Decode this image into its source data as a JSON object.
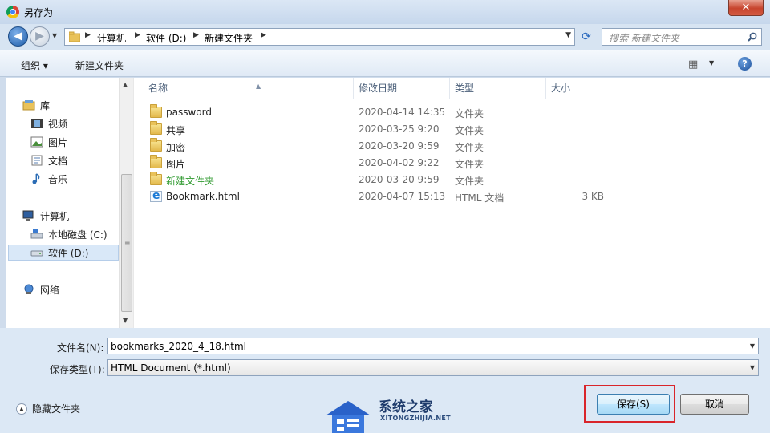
{
  "window": {
    "title": "另存为",
    "close_label": "✕"
  },
  "address": {
    "crumbs": [
      "计算机",
      "软件 (D:)",
      "新建文件夹"
    ],
    "search_placeholder": "搜索 新建文件夹"
  },
  "toolbar": {
    "organize_label": "组织 ▾",
    "new_folder_label": "新建文件夹",
    "help_label": "?"
  },
  "navigation": {
    "items": [
      {
        "label": "库",
        "icon": "library-icon"
      },
      {
        "label": "视频",
        "icon": "video-icon"
      },
      {
        "label": "图片",
        "icon": "picture-icon"
      },
      {
        "label": "文档",
        "icon": "document-icon"
      },
      {
        "label": "音乐",
        "icon": "music-icon"
      },
      {
        "label": "计算机",
        "icon": "computer-icon"
      },
      {
        "label": "本地磁盘 (C:)",
        "icon": "drive-icon"
      },
      {
        "label": "软件 (D:)",
        "icon": "drive-icon",
        "selected": true
      },
      {
        "label": "网络",
        "icon": "network-icon"
      }
    ]
  },
  "file_list": {
    "columns": [
      "名称",
      "修改日期",
      "类型",
      "大小"
    ],
    "rows": [
      {
        "name": "password",
        "date": "2020-04-14 14:35",
        "type": "文件夹",
        "size": "",
        "icon": "folder-icon"
      },
      {
        "name": "共享",
        "date": "2020-03-25 9:20",
        "type": "文件夹",
        "size": "",
        "icon": "folder-icon"
      },
      {
        "name": "加密",
        "date": "2020-03-20 9:59",
        "type": "文件夹",
        "size": "",
        "icon": "folder-icon"
      },
      {
        "name": "图片",
        "date": "2020-04-02 9:22",
        "type": "文件夹",
        "size": "",
        "icon": "folder-icon"
      },
      {
        "name": "新建文件夹",
        "date": "2020-03-20 9:59",
        "type": "文件夹",
        "size": "",
        "icon": "folder-icon",
        "highlight": "#2f9a2f"
      },
      {
        "name": "Bookmark.html",
        "date": "2020-04-07 15:13",
        "type": "HTML 文档",
        "size": "3 KB",
        "icon": "ie-html-icon"
      }
    ]
  },
  "form": {
    "filename_label": "文件名(N):",
    "filename_value": "bookmarks_2020_4_18.html",
    "filetype_label": "保存类型(T):",
    "filetype_value": "HTML Document (*.html)"
  },
  "footer": {
    "hide_folders_label": "隐藏文件夹",
    "save_label": "保存(S)",
    "cancel_label": "取消"
  },
  "watermark": {
    "title": "系统之家",
    "subtitle": "XITONGZHIJIA.NET"
  },
  "colors": {
    "highlight_box": "#d9252b",
    "accent": "#1d5ca8"
  }
}
